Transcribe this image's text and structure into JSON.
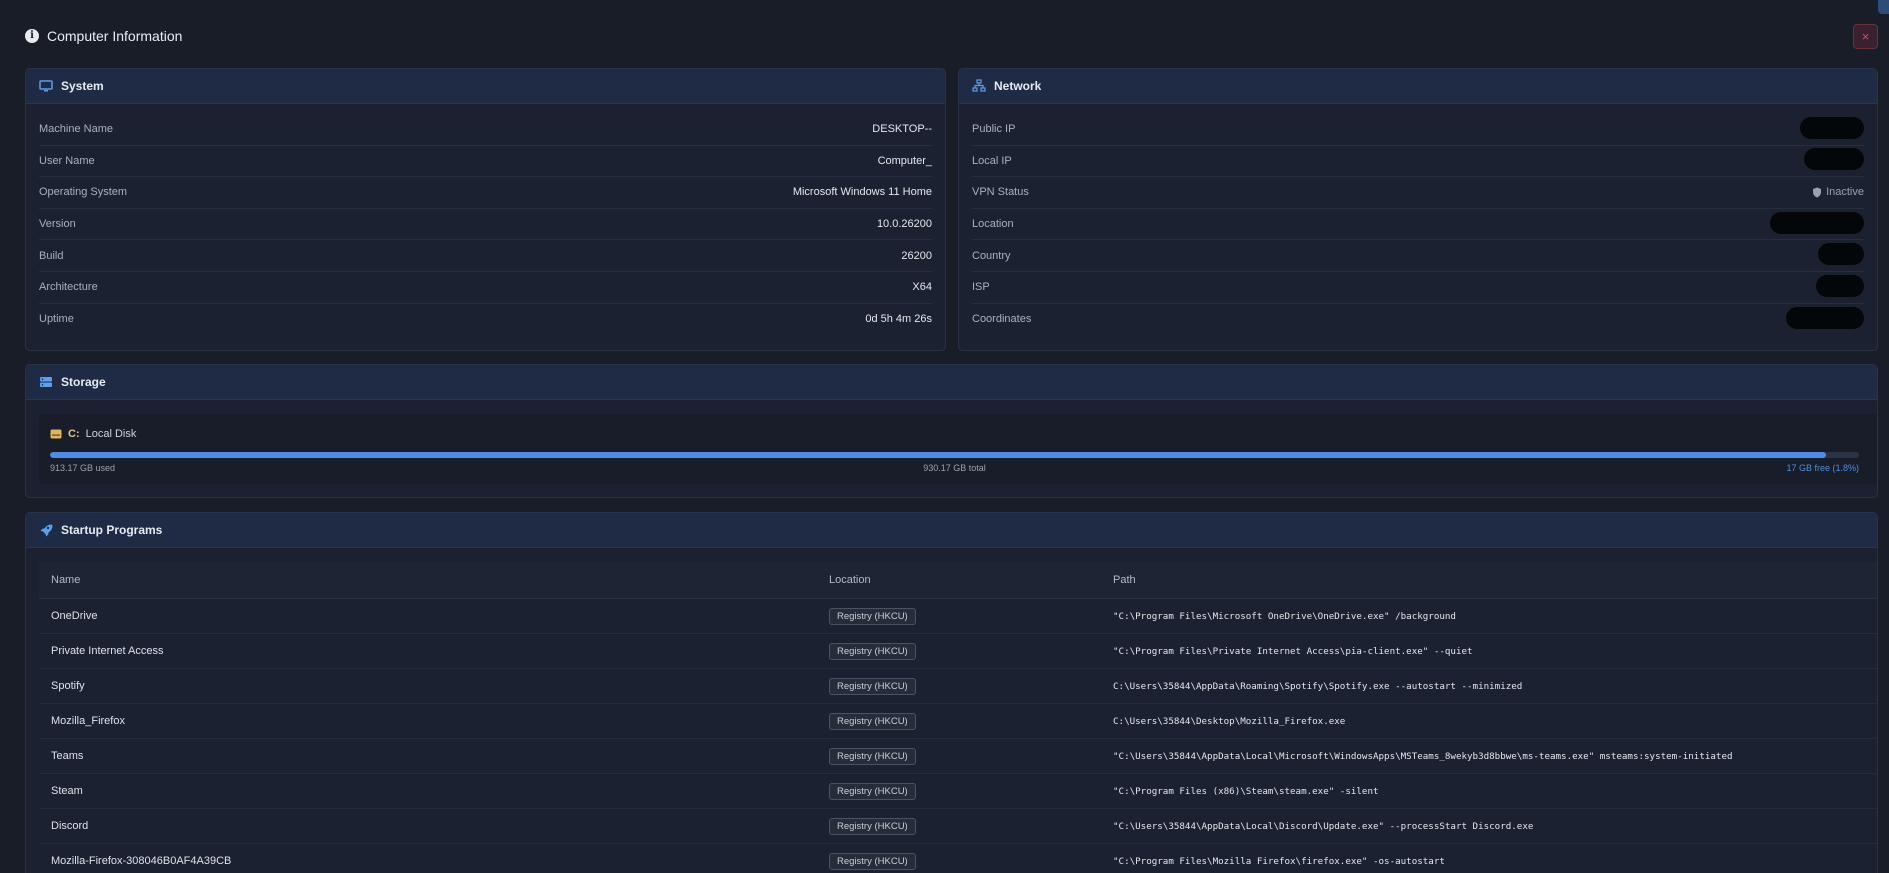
{
  "window": {
    "title": "Computer Information",
    "close_label": "×"
  },
  "system": {
    "title": "System",
    "rows": [
      {
        "label": "Machine Name",
        "value": "DESKTOP--"
      },
      {
        "label": "User Name",
        "value": "Computer_"
      },
      {
        "label": "Operating System",
        "value": "Microsoft Windows 11 Home"
      },
      {
        "label": "Version",
        "value": "10.0.26200"
      },
      {
        "label": "Build",
        "value": "26200"
      },
      {
        "label": "Architecture",
        "value": "X64"
      },
      {
        "label": "Uptime",
        "value": "0d 5h 4m 26s"
      }
    ]
  },
  "network": {
    "title": "Network",
    "rows": [
      {
        "label": "Public IP",
        "value": ""
      },
      {
        "label": "Local IP",
        "value": ""
      },
      {
        "label": "VPN Status",
        "value": "Inactive"
      },
      {
        "label": "Location",
        "value": ""
      },
      {
        "label": "Country",
        "value": ""
      },
      {
        "label": "ISP",
        "value": ""
      },
      {
        "label": "Coordinates",
        "value": ""
      }
    ]
  },
  "storage": {
    "title": "Storage",
    "disk": {
      "letter": "C:",
      "name": "Local Disk",
      "used": "913.17 GB used",
      "total": "930.17 GB total",
      "free": "17 GB free (1.8%)",
      "used_fraction": 0.982
    }
  },
  "startup": {
    "title": "Startup Programs",
    "columns": [
      "Name",
      "Location",
      "Path"
    ],
    "rows": [
      {
        "name": "OneDrive",
        "location": "Registry (HKCU)",
        "path": "\"C:\\Program Files\\Microsoft OneDrive\\OneDrive.exe\" /background"
      },
      {
        "name": "Private Internet Access",
        "location": "Registry (HKCU)",
        "path": "\"C:\\Program Files\\Private Internet Access\\pia-client.exe\" --quiet"
      },
      {
        "name": "Spotify",
        "location": "Registry (HKCU)",
        "path": "C:\\Users\\35844\\AppData\\Roaming\\Spotify\\Spotify.exe --autostart --minimized"
      },
      {
        "name": "Mozilla_Firefox",
        "location": "Registry (HKCU)",
        "path": "C:\\Users\\35844\\Desktop\\Mozilla_Firefox.exe"
      },
      {
        "name": "Teams",
        "location": "Registry (HKCU)",
        "path": "\"C:\\Users\\35844\\AppData\\Local\\Microsoft\\WindowsApps\\MSTeams_8wekyb3d8bbwe\\ms-teams.exe\" msteams:system-initiated"
      },
      {
        "name": "Steam",
        "location": "Registry (HKCU)",
        "path": "\"C:\\Program Files (x86)\\Steam\\steam.exe\" -silent"
      },
      {
        "name": "Discord",
        "location": "Registry (HKCU)",
        "path": "\"C:\\Users\\35844\\AppData\\Local\\Discord\\Update.exe\" --processStart Discord.exe"
      },
      {
        "name": "Mozilla-Firefox-308046B0AF4A39CB",
        "location": "Registry (HKCU)",
        "path": "\"C:\\Program Files\\Mozilla Firefox\\firefox.exe\" -os-autostart"
      }
    ]
  },
  "colors": {
    "accent": "#4d8ce8",
    "background": "#191d28",
    "card_header": "#1f2b45",
    "danger": "#d24d5d"
  },
  "icons": {
    "header": "info-icon",
    "system": "monitor-icon",
    "network": "network-icon",
    "storage": "storage-icon",
    "startup": "rocket-icon",
    "vpn": "shield-icon",
    "disk": "hard-drive-icon"
  }
}
